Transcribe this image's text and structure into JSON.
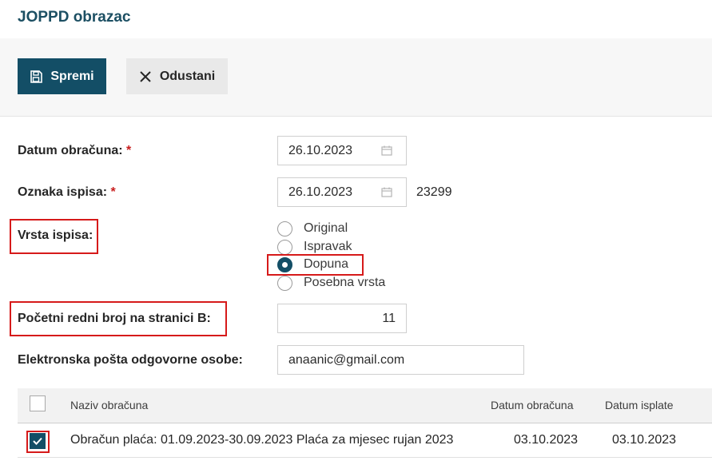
{
  "header": {
    "title": "JOPPD obrazac"
  },
  "toolbar": {
    "save_label": "Spremi",
    "cancel_label": "Odustani"
  },
  "form": {
    "datum_obracuna": {
      "label": "Datum obračuna:",
      "required_mark": "*",
      "value": "26.10.2023"
    },
    "oznaka_ispisa": {
      "label": "Oznaka ispisa:",
      "required_mark": "*",
      "value": "26.10.2023",
      "extra": "23299"
    },
    "vrsta_ispisa": {
      "label": "Vrsta ispisa:",
      "options": [
        "Original",
        "Ispravak",
        "Dopuna",
        "Posebna vrsta"
      ],
      "selected": "Dopuna"
    },
    "pocetni_redni_broj": {
      "label": "Početni redni broj na stranici B:",
      "value": "11"
    },
    "email": {
      "label": "Elektronska pošta odgovorne osobe:",
      "value": "anaanic@gmail.com"
    }
  },
  "table": {
    "columns": [
      "Naziv obračuna",
      "Datum obračuna",
      "Datum isplate"
    ],
    "rows": [
      {
        "checked": true,
        "naziv": "Obračun plaća: 01.09.2023-30.09.2023 Plaća za mjesec rujan 2023",
        "datum_obracuna": "03.10.2023",
        "datum_isplate": "03.10.2023"
      }
    ]
  },
  "colors": {
    "primary": "#134e66",
    "title": "#1c4f63",
    "highlight": "#d61a1a",
    "required": "#c81d1d"
  },
  "icons": {
    "save": "floppy-disk-icon",
    "cancel": "close-icon",
    "date": "calendar-icon",
    "check": "checkmark-icon"
  }
}
